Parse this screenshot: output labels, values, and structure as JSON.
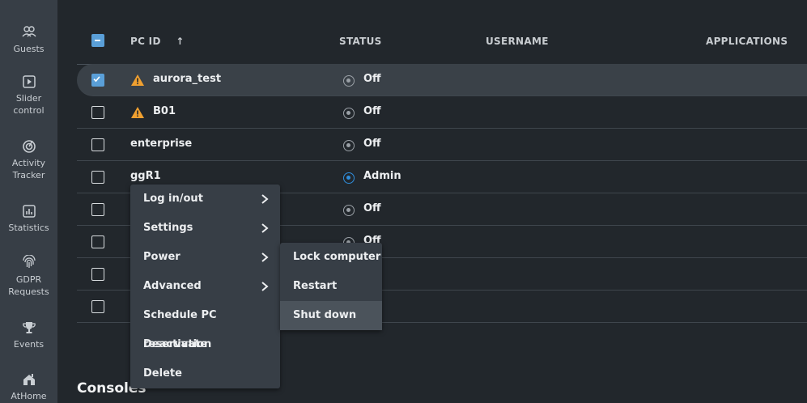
{
  "sidebar": {
    "items": [
      {
        "label": "Guests",
        "icon": "guests-icon"
      },
      {
        "label": "Slider control",
        "icon": "slider-control-icon"
      },
      {
        "label": "Activity Tracker",
        "icon": "activity-tracker-icon"
      },
      {
        "label": "Statistics",
        "icon": "statistics-icon"
      },
      {
        "label": "GDPR Requests",
        "icon": "fingerprint-icon"
      },
      {
        "label": "Events",
        "icon": "trophy-icon"
      },
      {
        "label": "AtHome",
        "icon": "home-icon"
      }
    ]
  },
  "table": {
    "columns": {
      "pc_id": "PC ID",
      "sort_indicator": "↑",
      "status": "STATUS",
      "username": "USERNAME",
      "applications": "APPLICATIONS"
    },
    "rows": [
      {
        "pc_id": "aurora_test",
        "status": "Off",
        "warning": true,
        "checked": true
      },
      {
        "pc_id": "B01",
        "status": "Off",
        "warning": true,
        "checked": false
      },
      {
        "pc_id": "enterprise",
        "status": "Off",
        "warning": false,
        "checked": false
      },
      {
        "pc_id": "ggR1",
        "status": "Admin",
        "warning": false,
        "checked": false
      },
      {
        "pc_id": "",
        "status": "Off",
        "warning": false,
        "checked": false
      },
      {
        "pc_id": "",
        "status": "Off",
        "warning": false,
        "checked": false
      },
      {
        "pc_id": "",
        "status": "",
        "warning": false,
        "checked": false
      },
      {
        "pc_id": "",
        "status": "",
        "warning": false,
        "checked": false
      }
    ]
  },
  "consoles_title": "Consoles",
  "context_menu": {
    "items": [
      {
        "label": "Log in/out",
        "has_submenu": true
      },
      {
        "label": "Settings",
        "has_submenu": true
      },
      {
        "label": "Power",
        "has_submenu": true
      },
      {
        "label": "Advanced",
        "has_submenu": true
      },
      {
        "label": "Schedule PC reservation",
        "has_submenu": false
      },
      {
        "label": "Deactivate",
        "has_submenu": false
      },
      {
        "label": "Delete",
        "has_submenu": false
      }
    ]
  },
  "power_submenu": {
    "items": [
      {
        "label": "Lock computer"
      },
      {
        "label": "Restart"
      },
      {
        "label": "Shut down"
      }
    ]
  },
  "colors": {
    "background": "#22272c",
    "sidebar": "#373e46",
    "accent": "#5a9fd8",
    "warning": "#f0a030",
    "admin": "#2f8ddb"
  }
}
